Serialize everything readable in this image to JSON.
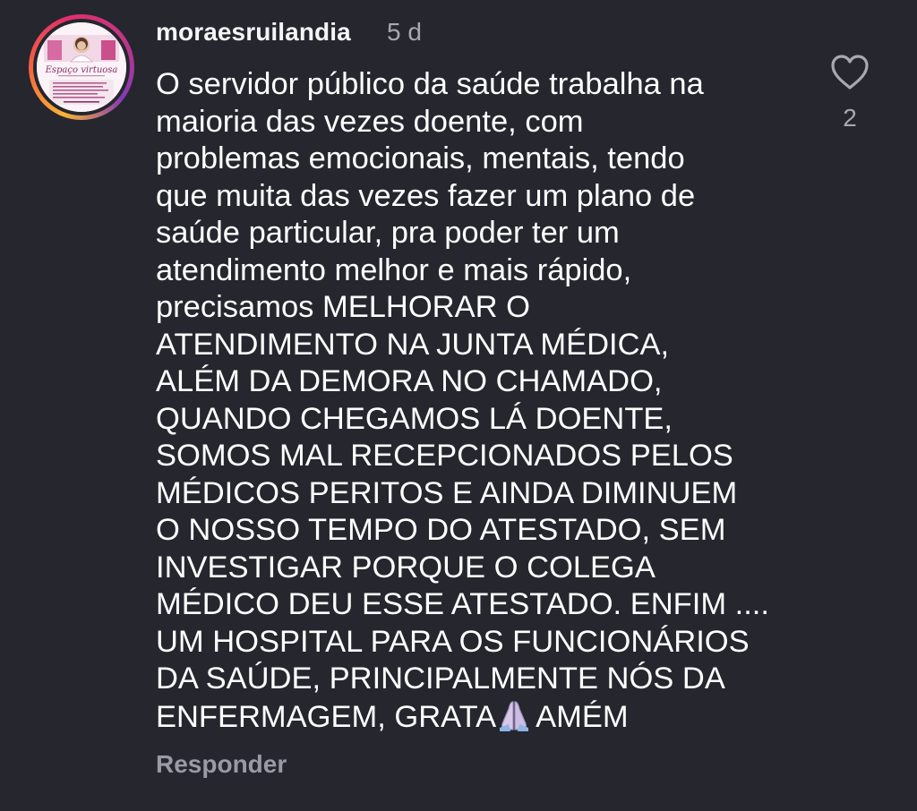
{
  "comment": {
    "username": "moraesruilandia",
    "timestamp": "5 d",
    "lines": [
      "O servidor público da saúde trabalha na",
      "maioria das vezes doente, com",
      "problemas emocionais, mentais, tendo",
      "que muita das vezes fazer um plano de",
      "saúde particular, pra poder ter um",
      "atendimento melhor e mais rápido,",
      "precisamos MELHORAR O",
      "ATENDIMENTO NA JUNTA MÉDICA,",
      "ALÉM DA DEMORA NO CHAMADO,",
      "QUANDO CHEGAMOS LÁ DOENTE,",
      "SOMOS MAL RECEPCIONADOS PELOS",
      "MÉDICOS PERITOS E AINDA DIMINUEM",
      "O NOSSO TEMPO DO ATESTADO, SEM",
      "INVESTIGAR PORQUE O COLEGA",
      "MÉDICO DEU ESSE ATESTADO. ENFIM ....",
      "UM HOSPITAL PARA OS FUNCIONÁRIOS",
      "DA SAÚDE, PRINCIPALMENTE NÓS DA"
    ],
    "last_line_before_emoji": "ENFERMAGEM, GRATA",
    "emoji": "folded-hands-icon",
    "last_line_after_emoji": "AMÉM",
    "reply_label": "Responder",
    "like_count": "2",
    "avatar": {
      "logo_text": "Espaço virtuosa"
    }
  },
  "colors": {
    "background": "#25262e",
    "text": "#ffffff",
    "muted": "#a8a8b0",
    "reply": "#9a9aa4",
    "avatar_ring": [
      "#f9b334",
      "#f56040",
      "#e1306c",
      "#c13584",
      "#833ab4"
    ]
  }
}
